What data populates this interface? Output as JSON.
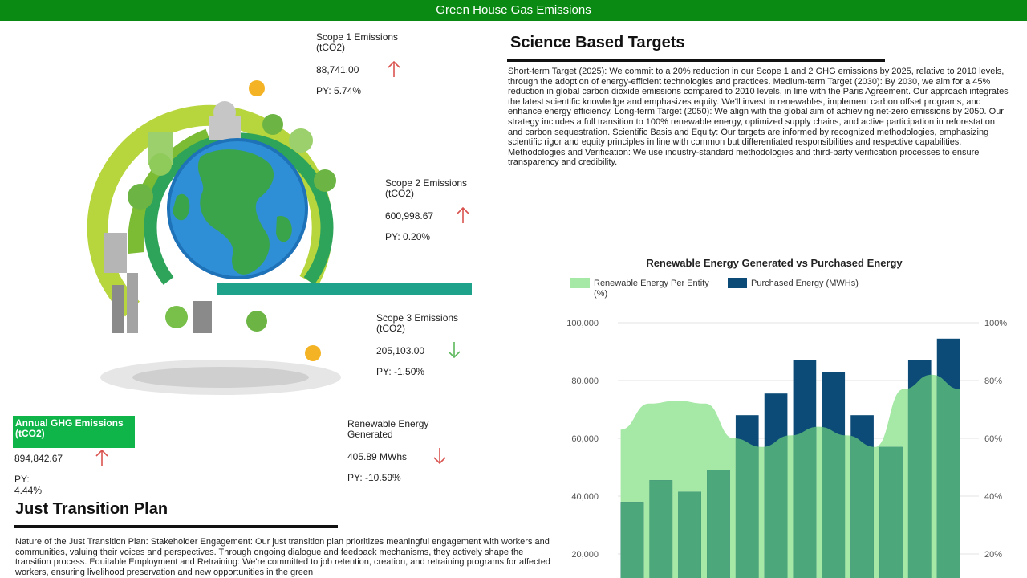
{
  "header": {
    "title": "Green House Gas Emissions"
  },
  "metrics": {
    "scope1": {
      "label": "Scope 1 Emissions (tCO2)",
      "value": "88,741.00",
      "py": "PY: 5.74%",
      "direction": "up",
      "arrow_color": "#d9534f"
    },
    "scope2": {
      "label": "Scope 2 Emissions (tCO2)",
      "value": "600,998.67",
      "py": "PY: 0.20%",
      "direction": "up",
      "arrow_color": "#d9534f"
    },
    "scope3": {
      "label": "Scope 3 Emissions (tCO2)",
      "value": "205,103.00",
      "py": "PY: -1.50%",
      "direction": "down",
      "arrow_color": "#5cb85c"
    },
    "annual": {
      "label": "Annual GHG Emissions (tCO2)",
      "value": "894,842.67",
      "py": "PY: 4.44%",
      "direction": "up",
      "arrow_color": "#d9534f"
    },
    "renewable": {
      "label": "Renewable Energy Generated",
      "value": "405.89 MWhs",
      "py": "PY: -10.59%",
      "direction": "down",
      "arrow_color": "#d9534f"
    }
  },
  "sbt": {
    "title": "Science Based Targets",
    "body": "Short-term Target (2025): We commit to a 20% reduction in our Scope 1 and 2 GHG emissions by 2025, relative to 2010 levels, through the adoption of energy-efficient technologies and practices.  Medium-term Target (2030): By 2030, we aim for a 45% reduction in global carbon dioxide emissions compared to 2010 levels, in line with the Paris Agreement. Our approach integrates the latest scientific knowledge and emphasizes equity. We'll invest in renewables, implement carbon offset programs, and enhance energy efficiency.  Long-term Target (2050): We align with the global aim of achieving net-zero emissions by 2050. Our strategy includes a full transition to 100% renewable energy, optimized supply chains, and active participation in reforestation and carbon sequestration.  Scientific Basis and Equity: Our targets are informed by recognized methodologies, emphasizing scientific rigor and equity principles in line with common but differentiated responsibilities and respective capabilities.  Methodologies and Verification: We use industry-standard methodologies and third-party verification processes to ensure transparency and credibility."
  },
  "jtp": {
    "title": "Just Transition Plan",
    "body": "Nature of the Just Transition Plan:  Stakeholder Engagement: Our just transition plan prioritizes meaningful engagement with workers and communities, valuing their voices and perspectives. Through ongoing dialogue and feedback mechanisms, they actively shape the transition process.  Equitable Employment and Retraining: We're committed to job retention, creation, and retraining programs for affected workers, ensuring livelihood preservation and new opportunities in the green"
  },
  "chart_data": {
    "type": "bar",
    "title": "Renewable Energy Generated vs Purchased Energy",
    "series": [
      {
        "name": "Renewable Energy Per Entity (%)",
        "type": "area",
        "axis": "right",
        "color": "#a6e8a6",
        "values": [
          63,
          72,
          73,
          72,
          60,
          57,
          61,
          64,
          61,
          57,
          77,
          82,
          77
        ]
      },
      {
        "name": "Purchased Energy (MWHs)",
        "type": "bar",
        "axis": "left",
        "color": "#0c4a78",
        "values": [
          38000,
          45500,
          41500,
          49000,
          68000,
          75500,
          87000,
          83000,
          68000,
          57000,
          87000,
          94500
        ]
      }
    ],
    "overlap_color": "#4ca77a",
    "y_left": {
      "ticks": [
        "100,000",
        "80,000",
        "60,000",
        "40,000",
        "20,000"
      ],
      "min": 0,
      "max": 100000
    },
    "y_right": {
      "ticks": [
        "100%",
        "80%",
        "60%",
        "40%",
        "20%"
      ],
      "min": 0,
      "max": 100
    },
    "grid": true,
    "legend": "top-left"
  }
}
